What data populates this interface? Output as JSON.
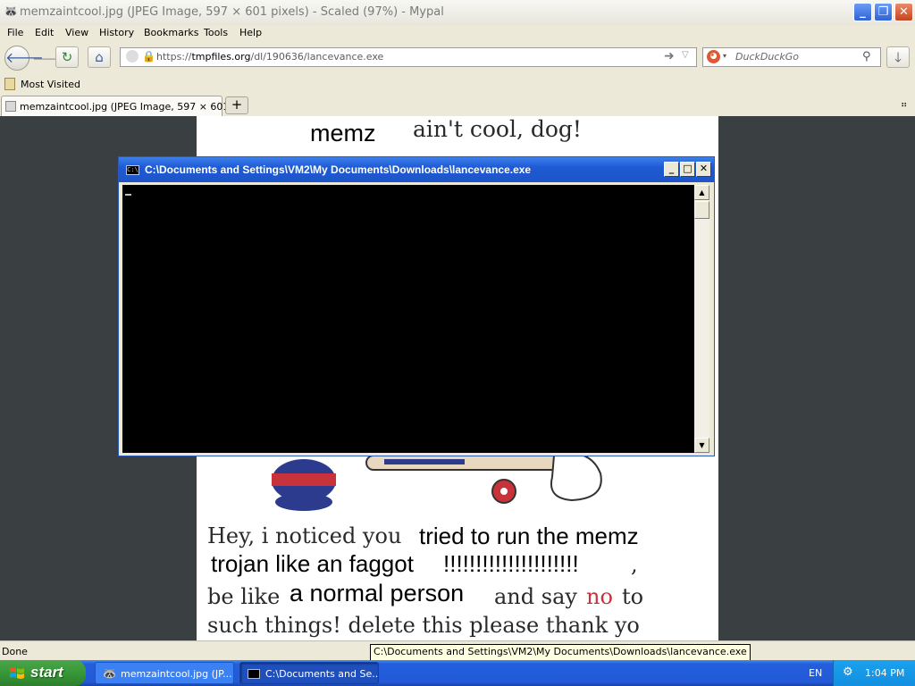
{
  "browser": {
    "window_title": "memzaintcool.jpg (JPEG Image, 597 × 601 pixels) - Scaled (97%) - Mypal",
    "menu": [
      "File",
      "Edit",
      "View",
      "History",
      "Bookmarks",
      "Tools",
      "Help"
    ],
    "url_prefix": "https://",
    "url_domain": "tmpfiles.org",
    "url_path": "/dl/190636/lancevance.exe",
    "search_placeholder": "DuckDuckGo",
    "bookmark_item": "Most Visited",
    "tab_title": "memzaintcool.jpg (JPEG Image, 597 × 601 p...",
    "status_text": "Done",
    "status_tooltip": "C:\\Documents and Settings\\VM2\\My Documents\\Downloads\\lancevance.exe"
  },
  "image": {
    "top_left": "memz",
    "top_right": "ain't cool, dog!",
    "line1_a": "Hey, i noticed you",
    "line1_b": "tried to run the memz",
    "line2_a": "trojan like an faggot",
    "line2_b": "!!!!!!!!!!!!!!!!!!!!!",
    "line2_c": ",",
    "line3_a": "be like",
    "line3_b": "a normal person",
    "line3_c": "and say",
    "line3_d": "no",
    "line3_e": "to",
    "line4": "such things! delete this please thank yo"
  },
  "console": {
    "title": "C:\\Documents and Settings\\VM2\\My Documents\\Downloads\\lancevance.exe",
    "icon_text": "C:\\"
  },
  "taskbar": {
    "start_label": "start",
    "tasks": [
      {
        "label": "memzaintcool.jpg (JP..."
      },
      {
        "label": "C:\\Documents and Se..."
      }
    ],
    "language": "EN",
    "clock": "1:04 PM"
  },
  "colors": {
    "console_title": "#1f55c8",
    "taskbar": "#245edb",
    "start_button": "#379737"
  }
}
